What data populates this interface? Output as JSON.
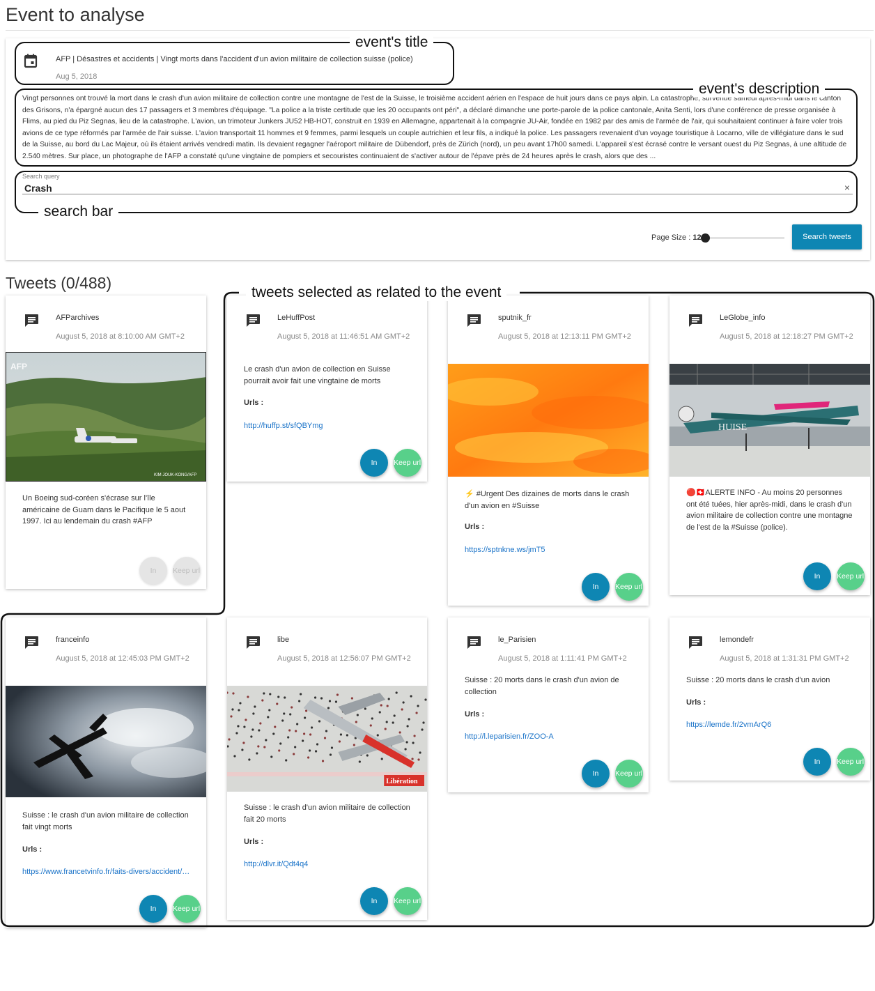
{
  "page_title": "Event to analyse",
  "annotations": {
    "title": "event's title",
    "description": "event's description",
    "search": "search bar",
    "selected": "tweets selected as related to the event"
  },
  "event": {
    "title": "AFP | Désastres et accidents | Vingt morts dans l'accident d'un avion militaire de collection suisse (police)",
    "date": "Aug 5, 2018",
    "description": "Vingt personnes ont trouvé la mort dans le crash d'un avion militaire de collection contre une montagne de l'est de la Suisse, le troisième accident aérien en l'espace de huit jours dans ce pays alpin. La catastrophe, survenue samedi après-midi dans le canton des Grisons, n'a épargné aucun des 17 passagers et 3 membres d'équipage. \"La police a la triste certitude que les 20 occupants ont péri\", a déclaré dimanche une porte-parole de la police cantonale, Anita Senti, lors d'une conférence de presse organisée à Flims, au pied du Piz Segnas, lieu de la catastrophe. L'avion, un trimoteur Junkers JU52 HB-HOT, construit en 1939 en Allemagne, appartenait à la compagnie JU-Air, fondée en 1982 par des amis de l'armée de l'air, qui souhaitaient continuer à faire voler trois avions de ce type réformés par l'armée de l'air suisse. L'avion transportait 11 hommes et 9 femmes, parmi lesquels un couple autrichien et leur fils, a indiqué la police. Les passagers revenaient d'un voyage touristique à Locarno, ville de villégiature dans le sud de la Suisse, au bord du Lac Majeur, où ils étaient arrivés vendredi matin. Ils devaient regagner l'aéroport militaire de Dübendorf, près de Zürich (nord), un peu avant 17h00 samedi. L'appareil s'est écrasé contre le versant ouest du Piz Segnas, à une altitude de 2.540 mètres. Sur place, un photographe de l'AFP a constaté qu'une vingtaine de pompiers et secouristes continuaient de s'activer autour de l'épave près de 24 heures après le crash, alors que des ..."
  },
  "search": {
    "label": "Search query",
    "value": "Crash",
    "clear": "×"
  },
  "page_size": {
    "label": "Page Size : ",
    "value": "12",
    "level": 0.0
  },
  "search_button": "Search tweets",
  "tweets_heading": "Tweets (0/488)",
  "urls_label": "Urls :",
  "btn_in": "In",
  "btn_keep": "Keep url",
  "tweets": [
    {
      "user": "AFParchives",
      "date": "August 5, 2018 at 8:10:00 AM GMT+2",
      "text": "Un Boeing sud-coréen s'écrase sur l'île américaine de Guam dans le Pacifique le 5 aout 1997. Ici au lendemain du crash #AFP",
      "url": "",
      "image": "crash-site-photo",
      "watermark": "AFP",
      "credit": "KIM JOUK-KONG/AFP"
    },
    {
      "user": "LeHuffPost",
      "date": "August 5, 2018 at 11:46:51 AM GMT+2",
      "text": "Le crash d'un avion de collection en Suisse pourrait avoir fait une vingtaine de morts",
      "url": "http://huffp.st/sfQBYmg"
    },
    {
      "user": "sputnik_fr",
      "date": "August 5, 2018 at 12:13:11 PM GMT+2",
      "text": "⚡ #Urgent Des dizaines de morts dans le crash d'un avion en #Suisse",
      "url": "https://sptnkne.ws/jmT5",
      "image": "orange-abstract"
    },
    {
      "user": "LeGlobe_info",
      "date": "August 5, 2018 at 12:18:27 PM GMT+2",
      "text": "🔴🇨🇭ALERTE INFO - Au moins 20 personnes ont été tuées, hier après-midi, dans le crash d'un avion militaire de collection contre une montagne de l'est de la #Suisse (police).",
      "url": "",
      "image": "hangar-plane",
      "plane_label": "HUISE"
    },
    {
      "user": "franceinfo",
      "date": "August 5, 2018 at 12:45:03 PM GMT+2",
      "text": "Suisse : le crash d'un avion militaire de collection fait vingt morts",
      "url": "https://www.francetvinfo.fr/faits-divers/accident/suisse-le-crash-dun-avion",
      "image": "plane-in-clouds"
    },
    {
      "user": "libe",
      "date": "August 5, 2018 at 12:56:07 PM GMT+2",
      "text": "Suisse : le crash d'un avion militaire de collection fait 20 morts",
      "url": "http://dlvr.it/Qdt4q4",
      "image": "airshow-crowd",
      "brand": "Libération"
    },
    {
      "user": "le_Parisien",
      "date": "August 5, 2018 at 1:11:41 PM GMT+2",
      "text": "Suisse : 20 morts dans le crash d'un avion de collection",
      "url": "http://l.leparisien.fr/ZOO-A"
    },
    {
      "user": "lemondefr",
      "date": "August 5, 2018 at 1:31:31 PM GMT+2",
      "text": "Suisse : 20 morts dans le crash d'un avion",
      "url": "https://lemde.fr/2vmArQ6"
    }
  ]
}
